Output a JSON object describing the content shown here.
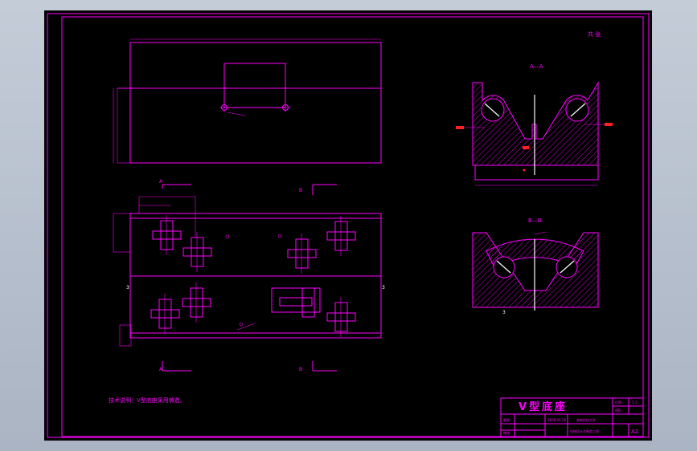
{
  "sheet": {
    "quantity_label": "共 张",
    "note": "技术说明：V型底座采用铸造。",
    "section_a_label": "A—A",
    "section_b_label": "B—B",
    "marker_a": "A",
    "marker_b": "B"
  },
  "title_block": {
    "title": "V型底座",
    "scale_label": "比例",
    "scale_value": "1:1",
    "material_label": "材料",
    "drawn_label": "制图",
    "checked_label": "审核",
    "school": "湖南科技大学",
    "class_info": "机械设计及制造二班",
    "sheet_size": "A2",
    "date": "2009.05.18"
  },
  "colors": {
    "line": "#ff00ff",
    "center": "#ffffff",
    "hatch_red": "#ff2020",
    "background": "#000000",
    "window": "#b9c2cf"
  }
}
